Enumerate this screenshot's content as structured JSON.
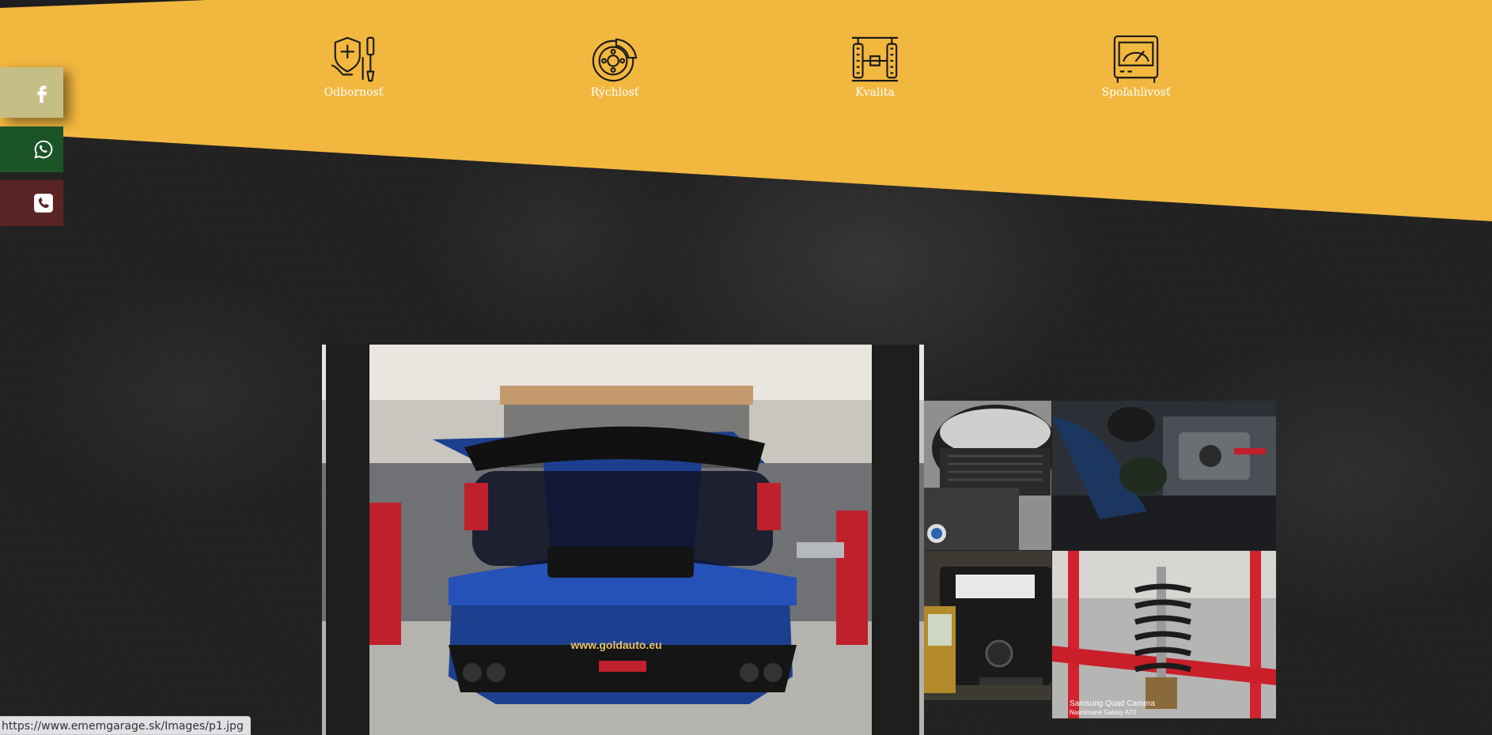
{
  "colors": {
    "accent_yellow": "#f2b73f",
    "dark_bg": "#232323",
    "facebook_bg": "#c6bf85",
    "whatsapp_bg": "#1b5426",
    "phone_bg": "#5a2424"
  },
  "features": [
    {
      "label": "Odbornosť",
      "icon": "tools-shield-icon"
    },
    {
      "label": "Rýchlosť",
      "icon": "brake-disc-icon"
    },
    {
      "label": "Kvalita",
      "icon": "axle-wheels-icon"
    },
    {
      "label": "Spoľahlivosť",
      "icon": "diagnostic-meter-icon"
    }
  ],
  "social": {
    "facebook_icon": "facebook-icon",
    "whatsapp_icon": "whatsapp-icon",
    "phone_icon": "phone-icon"
  },
  "gallery": {
    "main_plate_text": "www.goldauto.eu",
    "thumb4_caption_line1": "Samsung Quad Camera",
    "thumb4_caption_line2": "Nasnímané Galaxy A72"
  },
  "statusbar": {
    "url": "https://www.ememgarage.sk/Images/p1.jpg"
  }
}
